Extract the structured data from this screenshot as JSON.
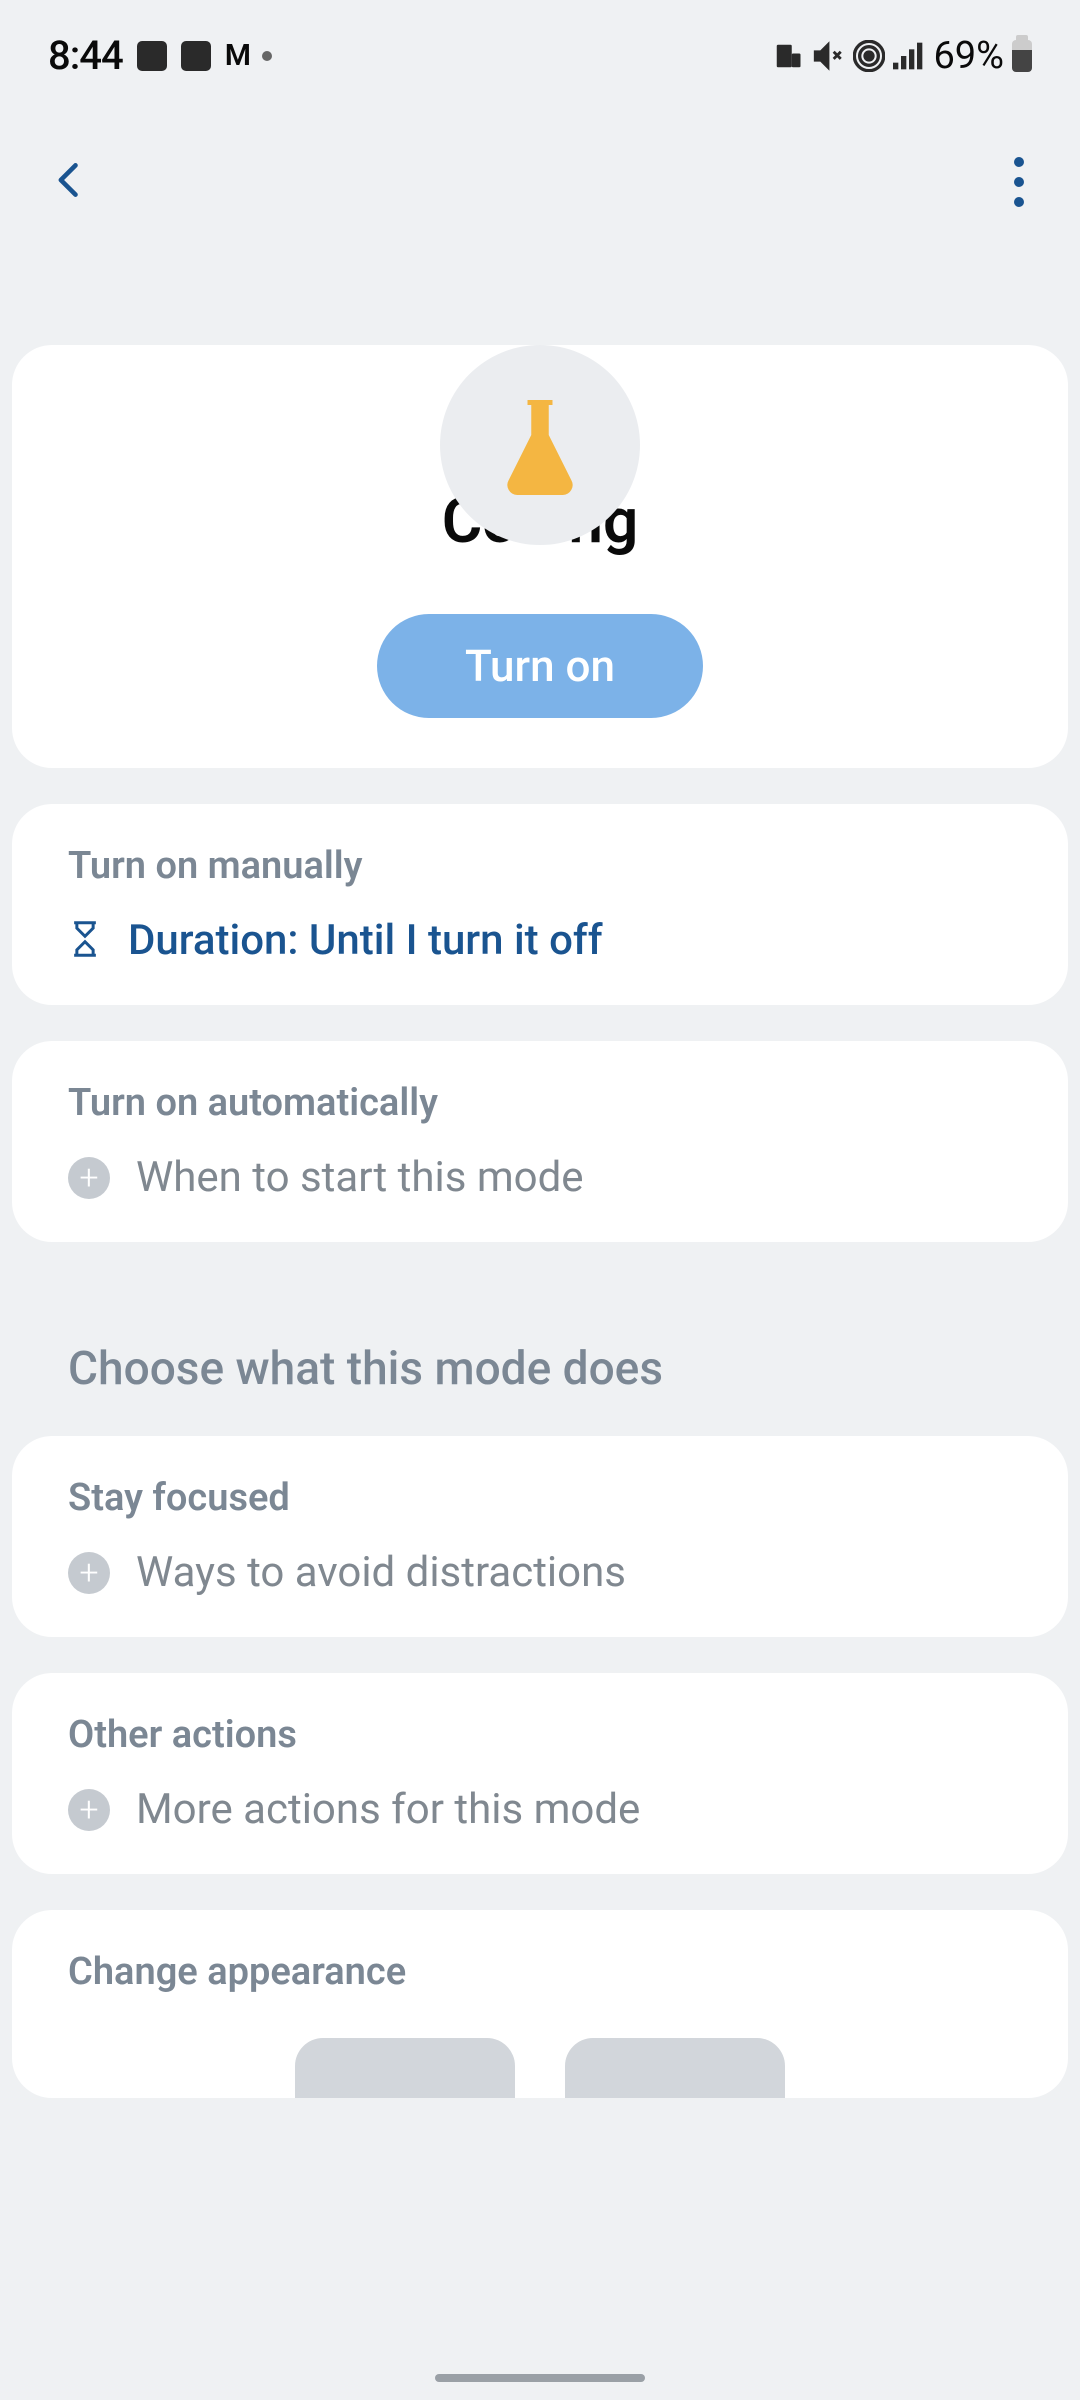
{
  "status": {
    "time": "8:44",
    "battery_pct": "69%"
  },
  "hero": {
    "title": "Coding",
    "button_label": "Turn on"
  },
  "manual": {
    "heading": "Turn on manually",
    "duration_label": "Duration: Until I turn it off"
  },
  "auto": {
    "heading": "Turn on automatically",
    "schedule_label": "When to start this mode"
  },
  "section_title": "Choose what this mode does",
  "focused": {
    "heading": "Stay focused",
    "label": "Ways to avoid distractions"
  },
  "other": {
    "heading": "Other actions",
    "label": "More actions for this mode"
  },
  "appearance": {
    "heading": "Change appearance"
  }
}
